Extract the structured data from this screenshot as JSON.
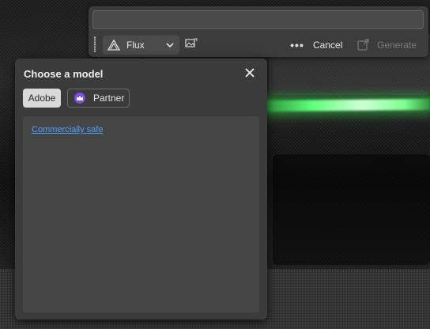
{
  "prompt_bar": {
    "prompt_value": "",
    "model_dropdown": {
      "selected": "Flux",
      "icon": "flux-triangle-icon"
    },
    "image_reference_icon": "image-reference-icon",
    "more_label": "•••",
    "cancel_label": "Cancel",
    "generate_label": "Generate",
    "generate_icon": "generate-icon"
  },
  "model_picker": {
    "title": "Choose a model",
    "close_icon": "close-icon",
    "tabs": [
      {
        "label": "Adobe",
        "active": true
      },
      {
        "label": "Partner",
        "active": false,
        "icon": "crown-icon"
      }
    ],
    "list": {
      "link_text": "Commercially safe"
    }
  },
  "colors": {
    "panel": "#3b3b3b",
    "list_bg": "#454545",
    "active_tab": "#d9d9d9",
    "link": "#4ea0ff",
    "partner_badge": "#7b4de0",
    "glow": "#5dff7a"
  }
}
